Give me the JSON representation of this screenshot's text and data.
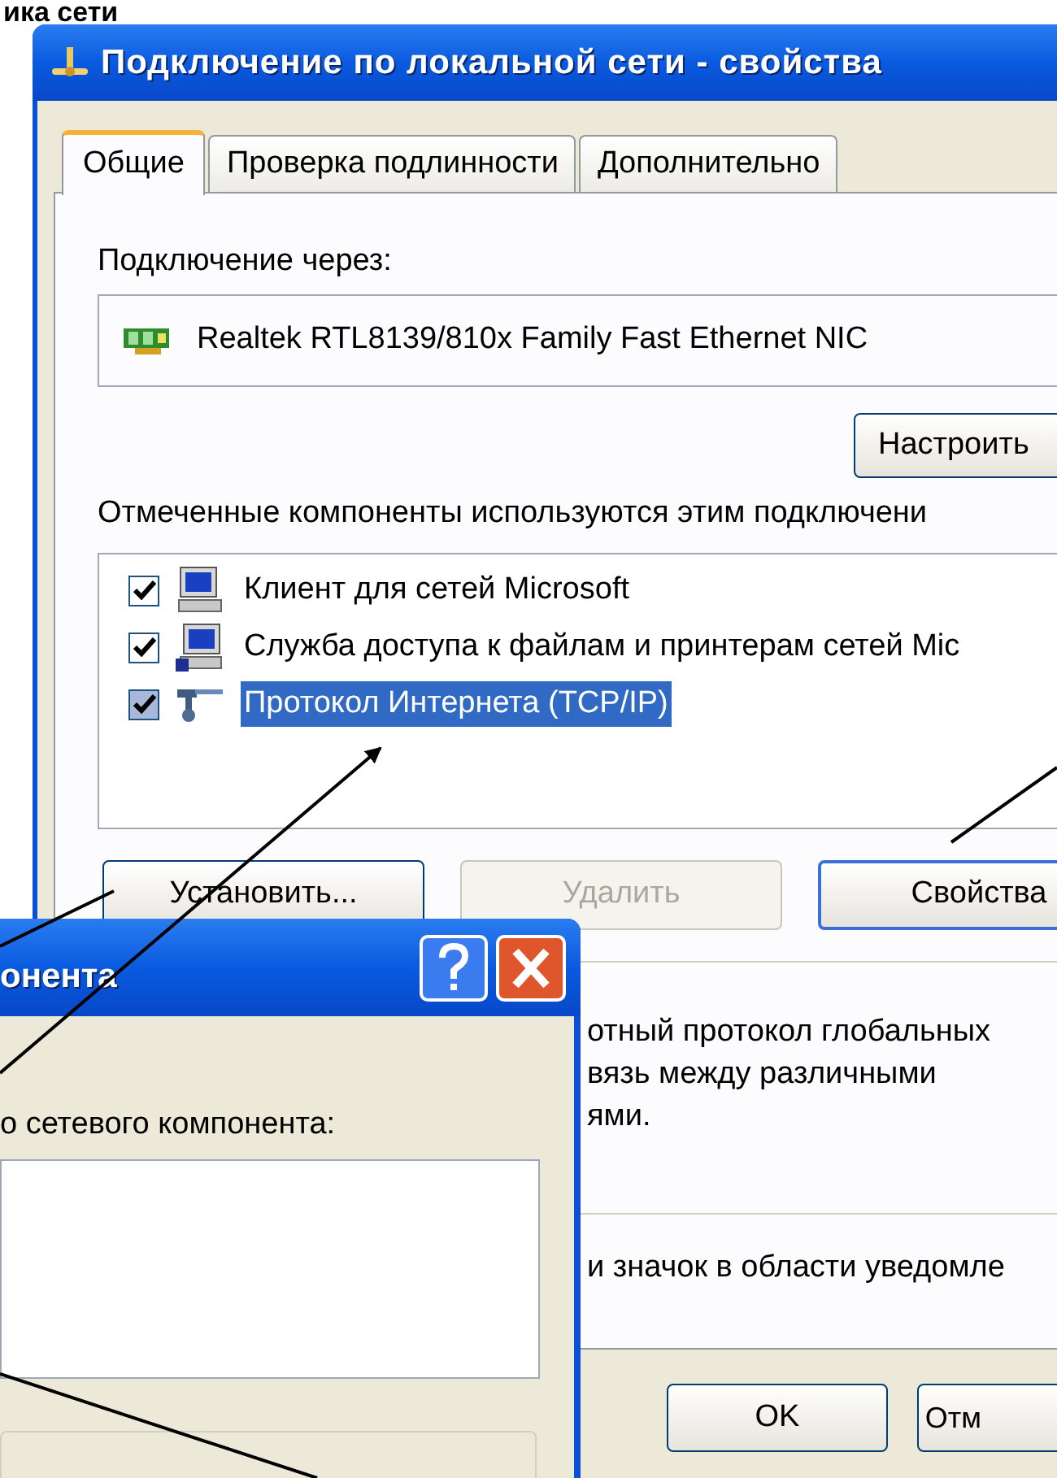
{
  "slide_title": "ика сети",
  "main_window": {
    "title": "Подключение по локальной сети - свойства",
    "tabs": [
      {
        "label": "Общие",
        "selected": true
      },
      {
        "label": "Проверка подлинности",
        "selected": false
      },
      {
        "label": "Дополнительно",
        "selected": false
      }
    ],
    "connect_via_label": "Подключение через:",
    "adapter": "Realtek RTL8139/810x Family Fast Ethernet NIC",
    "configure_button": "Настроить",
    "components_label": "Отмеченные компоненты используются этим подключени",
    "components": [
      {
        "kind": "client",
        "label": "Клиент для сетей Microsoft",
        "checked": true,
        "selected": false
      },
      {
        "kind": "service",
        "label": "Служба доступа к файлам и принтерам сетей Mic",
        "checked": true,
        "selected": false
      },
      {
        "kind": "protocol",
        "label": "Протокол Интернета (TCP/IP)",
        "checked": true,
        "selected": true
      }
    ],
    "buttons": [
      {
        "label": "Установить...",
        "disabled": false,
        "focused": false
      },
      {
        "label": "Удалить",
        "disabled": true,
        "focused": false
      },
      {
        "label": "Свойства",
        "disabled": false,
        "focused": true
      }
    ],
    "description_lines": [
      "отный протокол глобальных",
      "вязь между различными",
      "ями."
    ],
    "notify_label": "и значок в области уведомле",
    "footer_buttons": [
      "OK",
      "Отм"
    ]
  },
  "second_dialog": {
    "title": "онента",
    "prompt": "о сетевого компонента:"
  }
}
